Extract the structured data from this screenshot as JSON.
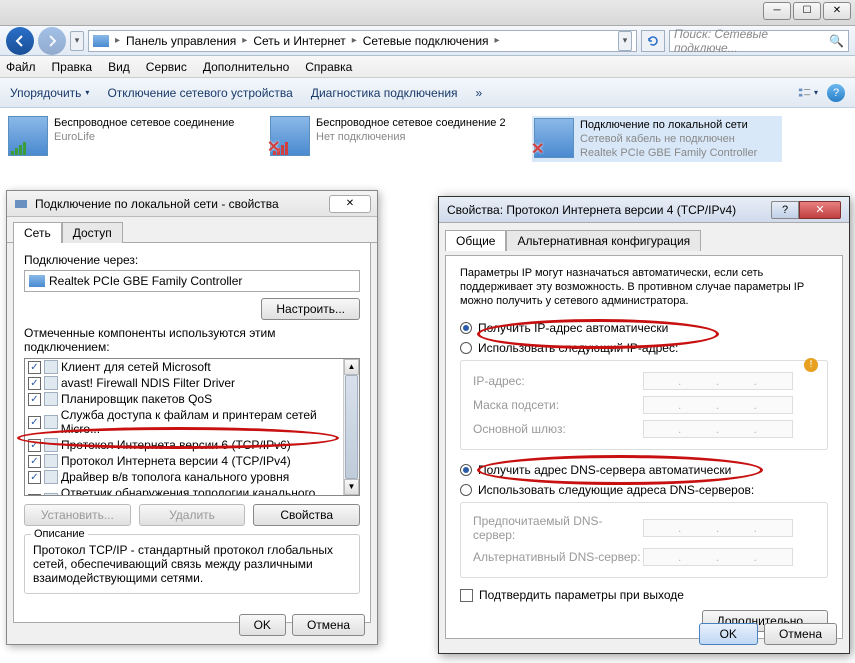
{
  "window_controls": {
    "min": "─",
    "max": "☐",
    "close": "✕"
  },
  "breadcrumb": {
    "item1": "Панель управления",
    "item2": "Сеть и Интернет",
    "item3": "Сетевые подключения"
  },
  "search": {
    "placeholder": "Поиск: Сетевые подключе..."
  },
  "menu": {
    "file": "Файл",
    "edit": "Правка",
    "view": "Вид",
    "service": "Сервис",
    "extra": "Дополнительно",
    "help": "Справка"
  },
  "commands": {
    "organize": "Упорядочить",
    "disable": "Отключение сетевого устройства",
    "diagnose": "Диагностика подключения",
    "more": "»"
  },
  "connections": [
    {
      "name": "Беспроводное сетевое соединение",
      "sub1": "",
      "sub2": "EuroLife"
    },
    {
      "name": "Беспроводное сетевое соединение 2",
      "sub1": "Нет подключения",
      "sub2": ""
    },
    {
      "name": "Подключение по локальной сети",
      "sub1": "Сетевой кабель не подключен",
      "sub2": "Realtek PCIe GBE Family Controller"
    }
  ],
  "props": {
    "title": "Подключение по локальной сети - свойства",
    "tab_net": "Сеть",
    "tab_access": "Доступ",
    "connect_via": "Подключение через:",
    "adapter": "Realtek PCIe GBE Family Controller",
    "configure": "Настроить...",
    "components_label": "Отмеченные компоненты используются этим подключением:",
    "components": [
      "Клиент для сетей Microsoft",
      "avast! Firewall NDIS Filter Driver",
      "Планировщик пакетов QoS",
      "Служба доступа к файлам и принтерам сетей Micro...",
      "Протокол Интернета версии 6 (TCP/IPv6)",
      "Протокол Интернета версии 4 (TCP/IPv4)",
      "Драйвер в/в тополога канального уровня",
      "Ответчик обнаружения топологии канального уровня"
    ],
    "install": "Установить...",
    "remove": "Удалить",
    "properties": "Свойства",
    "desc_legend": "Описание",
    "desc_text": "Протокол TCP/IP - стандартный протокол глобальных сетей, обеспечивающий связь между различными взаимодействующими сетями.",
    "ok": "OK",
    "cancel": "Отмена"
  },
  "ip": {
    "title": "Свойства: Протокол Интернета версии 4 (TCP/IPv4)",
    "tab_general": "Общие",
    "tab_alt": "Альтернативная конфигурация",
    "info": "Параметры IP могут назначаться автоматически, если сеть поддерживает эту возможность. В противном случае параметры IP можно получить у сетевого администратора.",
    "auto_ip": "Получить IP-адрес автоматически",
    "use_ip": "Использовать следующий IP-адрес:",
    "ip_addr": "IP-адрес:",
    "mask": "Маска подсети:",
    "gateway": "Основной шлюз:",
    "auto_dns": "Получить адрес DNS-сервера автоматически",
    "use_dns": "Использовать следующие адреса DNS-серверов:",
    "pref_dns": "Предпочитаемый DNS-сервер:",
    "alt_dns": "Альтернативный DNS-сервер:",
    "validate": "Подтвердить параметры при выходе",
    "advanced": "Дополнительно...",
    "ok": "OK",
    "cancel": "Отмена"
  }
}
